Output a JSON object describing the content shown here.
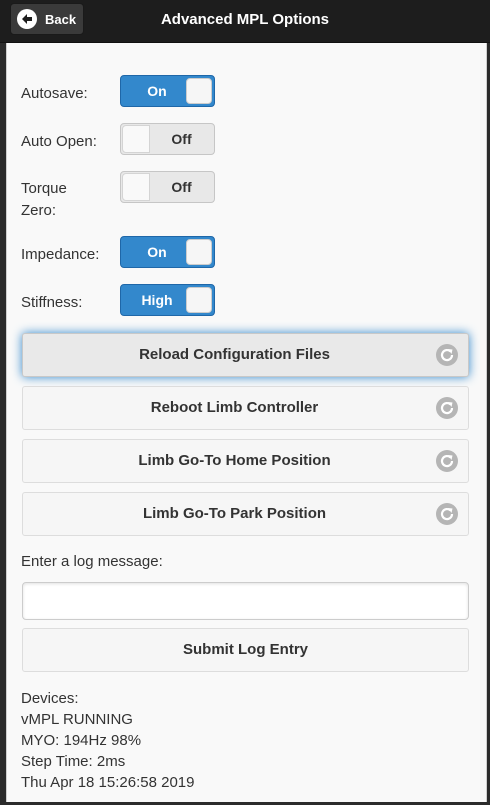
{
  "header": {
    "back_label": "Back",
    "back_icon": "arrow-left-icon",
    "title": "Advanced MPL Options"
  },
  "options": [
    {
      "label": "Autosave:",
      "state": "On",
      "on": true
    },
    {
      "label": "Auto Open:",
      "state": "Off",
      "on": false
    },
    {
      "label_line1": "Torque",
      "label_line2": "Zero:",
      "state": "Off",
      "on": false
    },
    {
      "label": "Impedance:",
      "state": "On",
      "on": true
    },
    {
      "label": "Stiffness:",
      "state": "High",
      "on": true
    }
  ],
  "actions": [
    {
      "label": "Reload Configuration Files",
      "icon": "refresh-icon"
    },
    {
      "label": "Reboot Limb Controller",
      "icon": "refresh-icon"
    },
    {
      "label": "Limb Go-To Home Position",
      "icon": "refresh-icon"
    },
    {
      "label": "Limb Go-To Park Position",
      "icon": "refresh-icon"
    }
  ],
  "log": {
    "prompt": "Enter a log message:",
    "value": "",
    "submit_label": "Submit Log Entry"
  },
  "status": {
    "devices_label": "Devices:",
    "lines": [
      "vMPL RUNNING",
      "MYO: 194Hz 98%",
      "Step Time: 2ms",
      "Thu Apr 18 15:26:58 2019"
    ]
  },
  "colors": {
    "accent": "#3388cc",
    "header_bg": "#1d1d1d",
    "content_bg": "#f9f9f9"
  }
}
